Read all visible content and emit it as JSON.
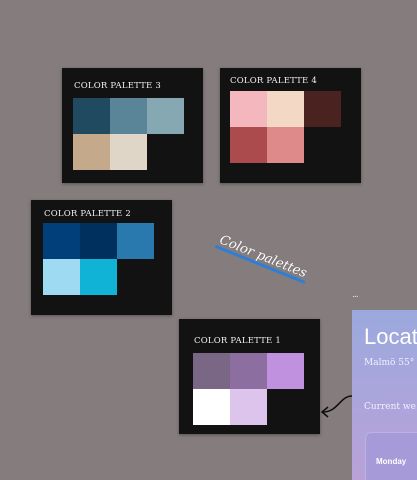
{
  "palettes": [
    {
      "title": "COLOR PALETTE 3",
      "swatches": [
        "#1f4a5f",
        "#5a8498",
        "#86a8b3",
        "#c5a98b",
        "#e0d6c8"
      ]
    },
    {
      "title": "COLOR PALETTE 4",
      "swatches": [
        "#f4b7bd",
        "#f3d8c6",
        "#4a2321",
        "#ab4b4d",
        "#de8a8b"
      ]
    },
    {
      "title": "COLOR PALETTE 2",
      "swatches": [
        "#003f7a",
        "#00305e",
        "#2a79ae",
        "#9edaf1",
        "#10b3d6"
      ]
    },
    {
      "title": "COLOR PALETTE 1",
      "swatches": [
        "#7a6685",
        "#8d6ea0",
        "#bf91de",
        "#ffffff",
        "#dcc4ec"
      ]
    }
  ],
  "annotation": {
    "text": "Color palettes",
    "underline_color": "#2d7fd6"
  },
  "weather_widget": {
    "title": "Locat",
    "subtitle": "Malmö 55°",
    "current_label": "Current we",
    "day_label": "Monday"
  },
  "menu": {
    "dots": "..."
  }
}
